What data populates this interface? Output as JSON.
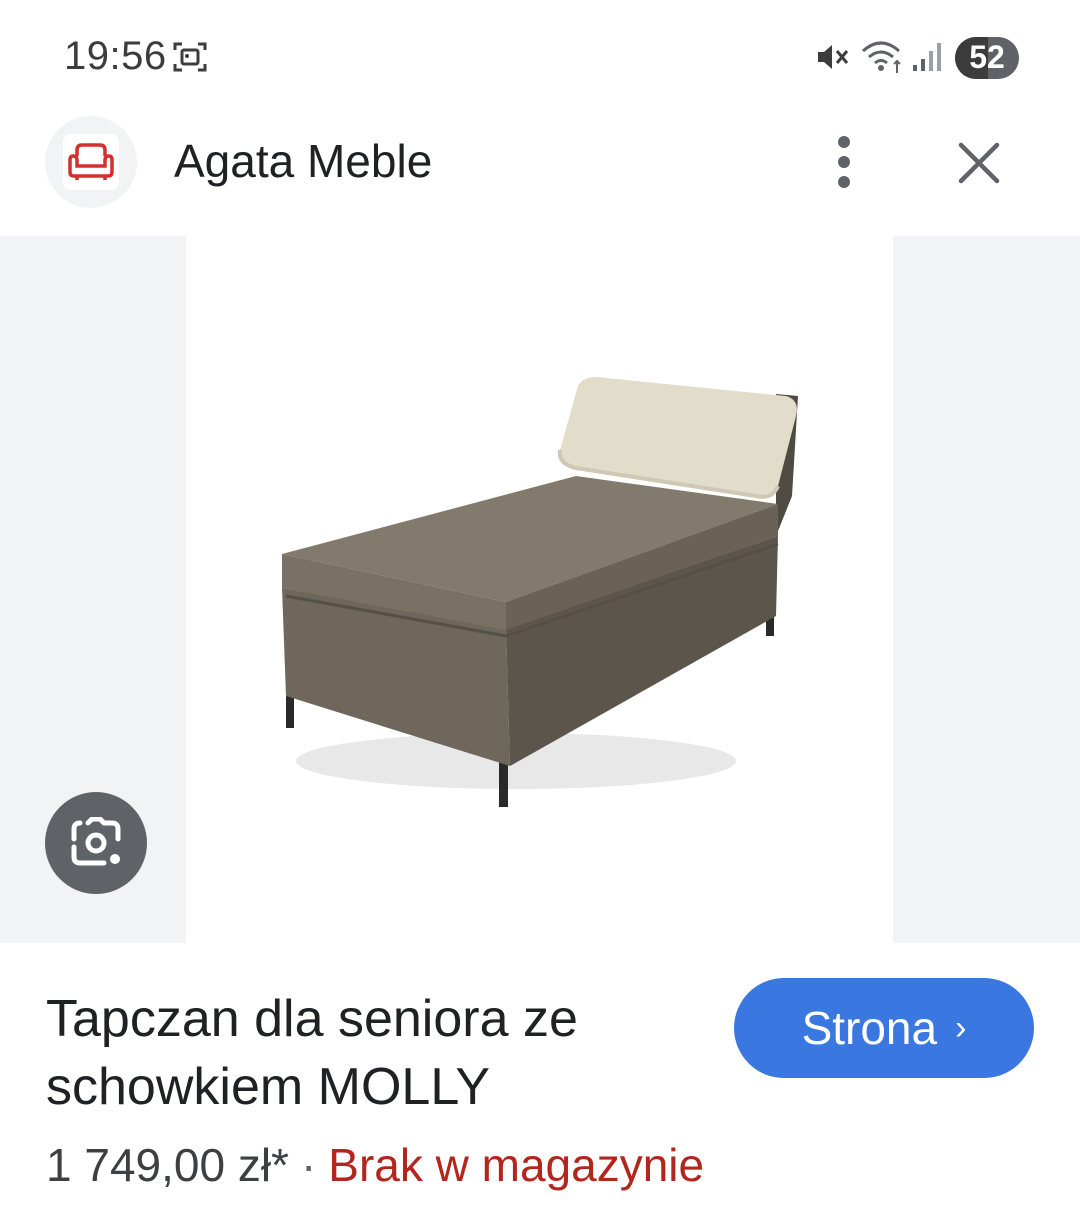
{
  "status_bar": {
    "time": "19:56",
    "battery_level": "52",
    "battery_percent": 52,
    "icons": [
      "screenshot-icon",
      "mute-icon",
      "wifi-icon",
      "signal-icon"
    ]
  },
  "header": {
    "site_name": "Agata Meble",
    "logo_icon": "armchair-logo-icon",
    "brand_color": "#d32f2f",
    "menu_icon": "more-vert-icon",
    "close_icon": "close-icon"
  },
  "image": {
    "subject": "tapczan",
    "lens_icon": "google-lens-icon"
  },
  "product": {
    "title": "Tapczan dla seniora ze schowkiem MOLLY",
    "price": "1 749,00 zł*",
    "separator": "·",
    "availability": "Brak w magazynie",
    "availability_color": "#b3261e"
  },
  "visit_button": {
    "label": "Strona",
    "chevron": "›",
    "color": "#3a77e0"
  }
}
